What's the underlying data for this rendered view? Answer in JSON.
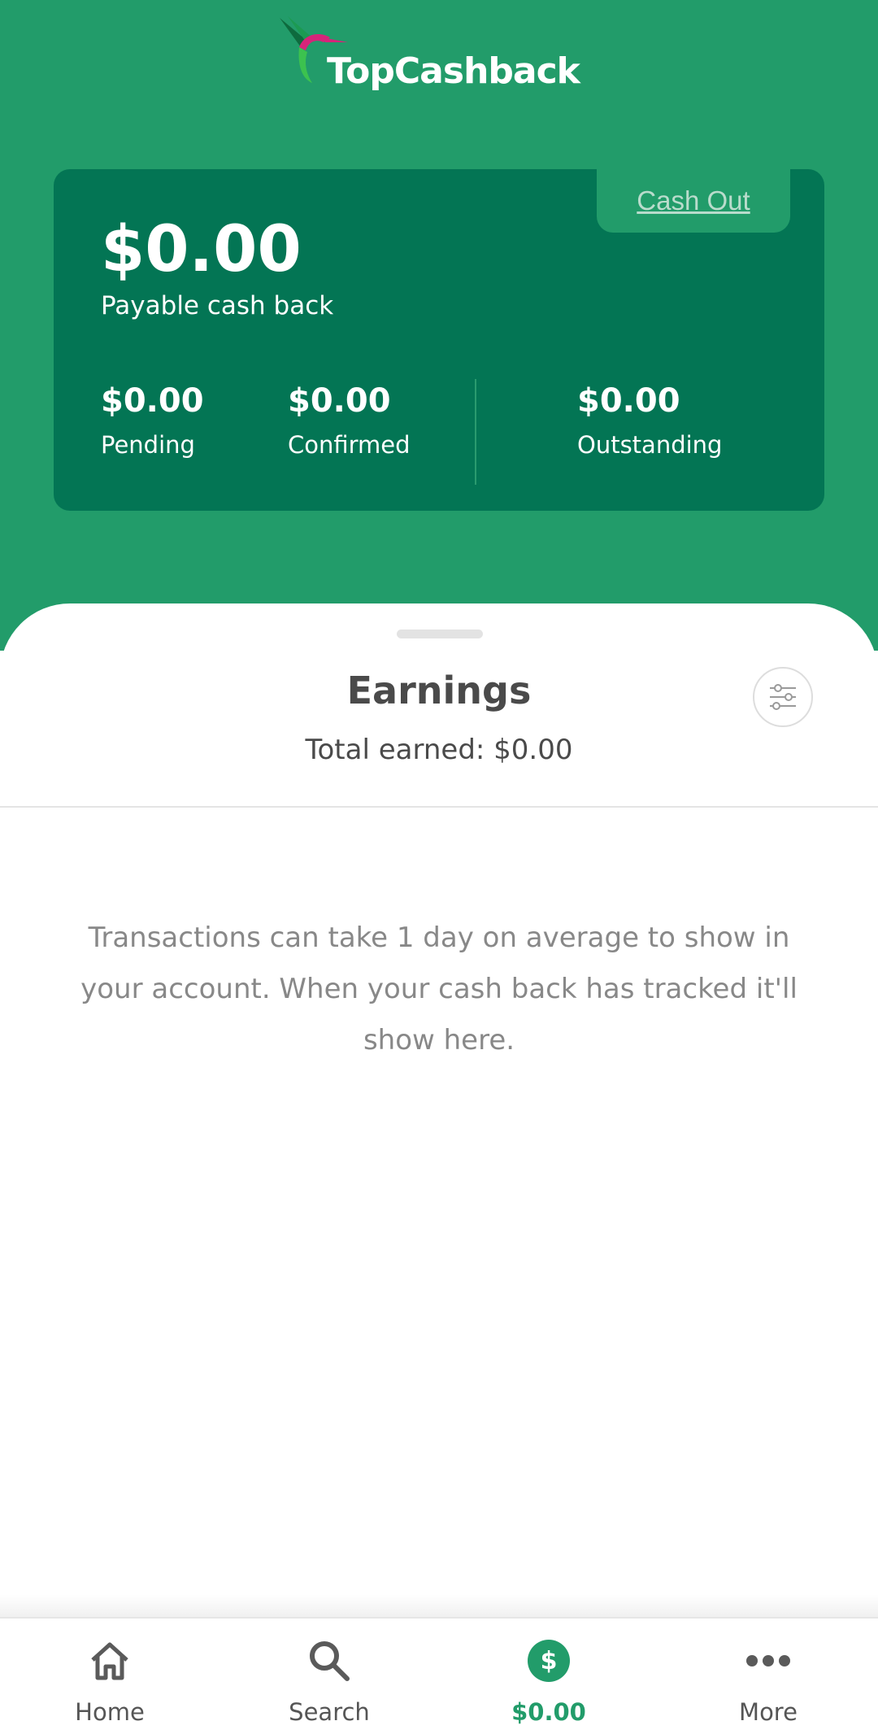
{
  "header": {
    "logo_text": "TopCashback"
  },
  "balance": {
    "cash_out_label": "Cash Out",
    "payable_amount": "$0.00",
    "payable_label": "Payable cash back",
    "pending_amount": "$0.00",
    "pending_label": "Pending",
    "confirmed_amount": "$0.00",
    "confirmed_label": "Confirmed",
    "outstanding_amount": "$0.00",
    "outstanding_label": "Outstanding"
  },
  "earnings": {
    "title": "Earnings",
    "total_earned": "Total earned: $0.00",
    "empty_message": "Transactions can take 1 day on average to show in your account. When your cash back has tracked it'll show here.",
    "filter_icon": "sliders-icon"
  },
  "nav": {
    "items": [
      {
        "label": "Home",
        "icon": "home-icon"
      },
      {
        "label": "Search",
        "icon": "search-icon"
      },
      {
        "label": "$0.00",
        "icon": "dollar-icon",
        "active": true
      },
      {
        "label": "More",
        "icon": "more-icon"
      }
    ]
  },
  "colors": {
    "brand_green": "#229c6a",
    "card_green": "#037554",
    "text_gray": "#4a4a4a"
  }
}
